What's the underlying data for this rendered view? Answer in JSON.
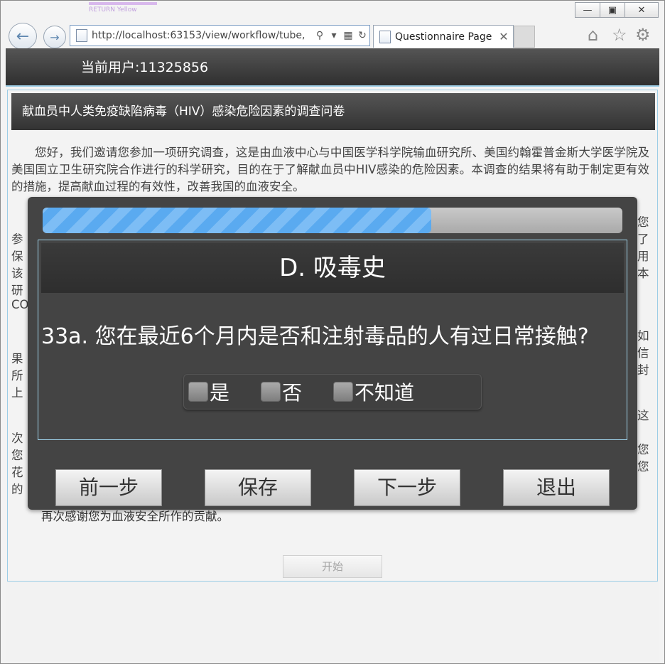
{
  "browser": {
    "ghost_title": "RETURN Yellow",
    "address": "http://localhost:63153/view/workflow/tube,",
    "tab_title": "Questionnaire Page"
  },
  "header": {
    "user_label": "当前用户:11325856"
  },
  "survey": {
    "title": "献血员中人类免疫缺陷病毒（HIV）感染危险因素的调查问卷",
    "intro": "您好，我们邀请您参加一项研究调查，这是由血液中心与中国医学科学院输血研究所、美国约翰霍普金斯大学医学院及美国国立卫生研究院合作进行的科学研究，目的在于了解献血员中HIV感染的危险因素。本调查的结果将有助于制定更有效的措施，提高献血过程的有效性，改善我国的血液安全。",
    "partial_left": [
      "参",
      "保",
      "该",
      "研",
      "CO",
      "",
      "果",
      "所",
      "上",
      "",
      "次",
      "您",
      "花",
      "的"
    ],
    "partial_right": [
      "您",
      "了",
      "用",
      "本",
      "",
      "如",
      "信",
      "封",
      "",
      "这",
      "",
      "您",
      "您"
    ],
    "thanks": "再次感谢您为血液安全所作的贡献。",
    "start_label": "开始"
  },
  "modal": {
    "progress": 0.67,
    "section_title": "D. 吸毒史",
    "question": "33a. 您在最近6个月内是否和注射毒品的人有过日常接触?",
    "options": [
      "是",
      "否",
      "不知道"
    ],
    "buttons": {
      "prev": "前一步",
      "save": "保存",
      "next": "下一步",
      "exit": "退出"
    }
  },
  "colors": {
    "progress_fill": "#5aaaf0",
    "modal_bg": "#444444",
    "frame_border": "#9ccde6"
  }
}
